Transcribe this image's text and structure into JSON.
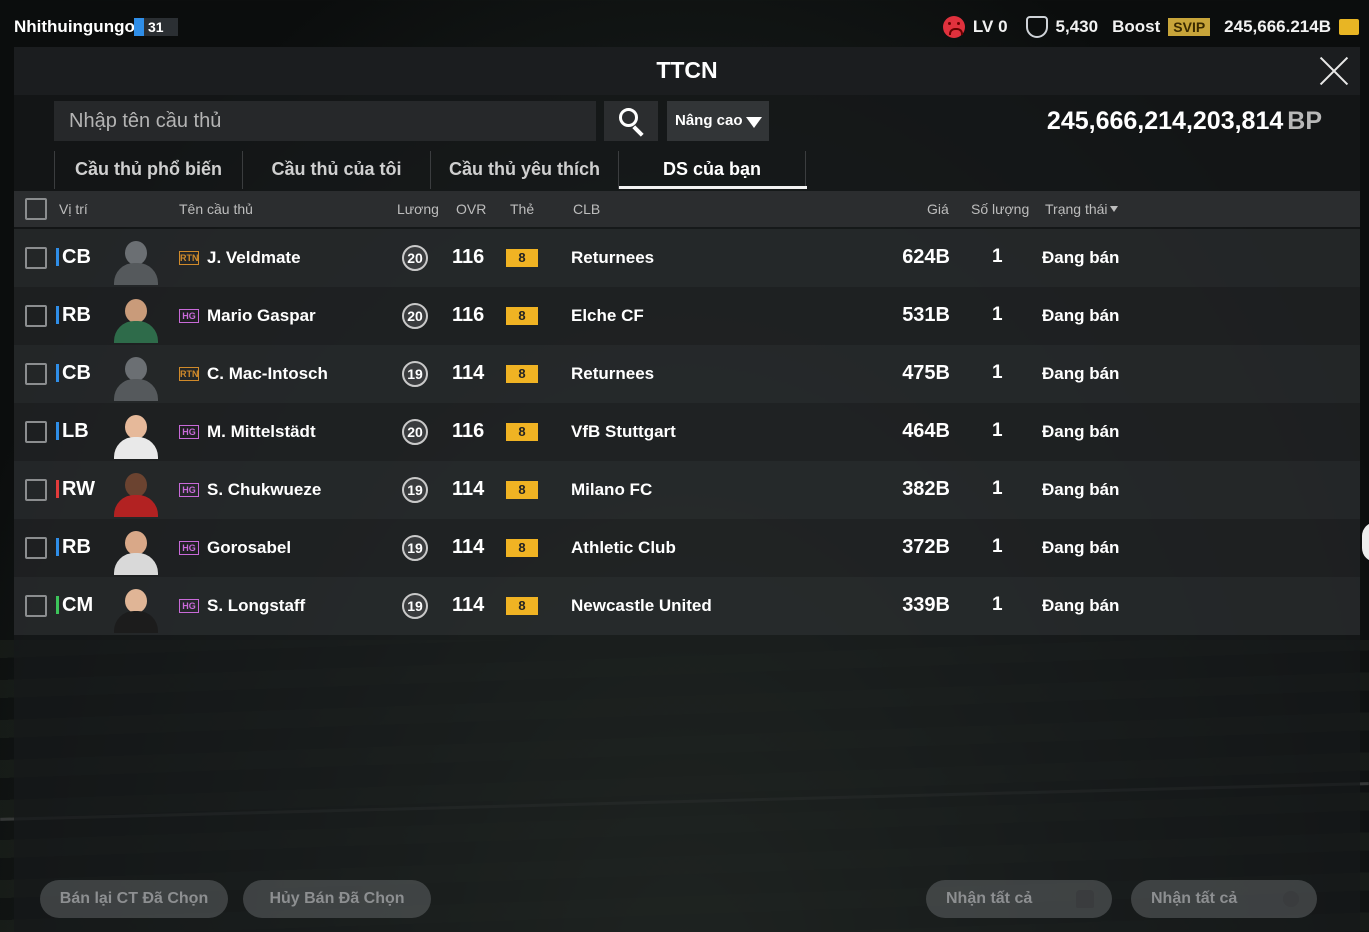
{
  "topbar": {
    "username": "Nhithuingungok",
    "level": "31",
    "lv_label": "LV 0",
    "trophy_value": "5,430",
    "boost_label": "Boost",
    "svip_label": "SVIP",
    "coins": "245,666.214B"
  },
  "panel": {
    "title": "TTCN",
    "search_placeholder": "Nhập tên cầu thủ",
    "advanced_label": "Nâng cao",
    "balance_value": "245,666,214,203,814",
    "balance_unit": "BP"
  },
  "tabs": [
    {
      "label": "Cầu thủ phổ biến",
      "active": false
    },
    {
      "label": "Cầu thủ của tôi",
      "active": false
    },
    {
      "label": "Cầu thủ yêu thích",
      "active": false
    },
    {
      "label": "DS của bạn",
      "active": true
    }
  ],
  "table": {
    "headers": {
      "position": "Vị trí",
      "name": "Tên cầu thủ",
      "wage": "Lương",
      "ovr": "OVR",
      "card": "Thẻ",
      "club": "CLB",
      "price": "Giá",
      "quantity": "Số lượng",
      "status": "Trạng thái"
    },
    "rows": [
      {
        "position": "CB",
        "pos_color": "#2f8ee8",
        "season": "RTN",
        "name": "J. Veldmate",
        "wage": "20",
        "ovr": "116",
        "grade": "8",
        "club": "Returnees",
        "price": "624B",
        "qty": "1",
        "status": "Đang bán"
      },
      {
        "position": "RB",
        "pos_color": "#2f8ee8",
        "season": "HG",
        "name": "Mario Gaspar",
        "wage": "20",
        "ovr": "116",
        "grade": "8",
        "club": "Elche CF",
        "price": "531B",
        "qty": "1",
        "status": "Đang bán"
      },
      {
        "position": "CB",
        "pos_color": "#2f8ee8",
        "season": "RTN",
        "name": "C. Mac-Intosch",
        "wage": "19",
        "ovr": "114",
        "grade": "8",
        "club": "Returnees",
        "price": "475B",
        "qty": "1",
        "status": "Đang bán"
      },
      {
        "position": "LB",
        "pos_color": "#2f8ee8",
        "season": "HG",
        "name": "M. Mittelstädt",
        "wage": "20",
        "ovr": "116",
        "grade": "8",
        "club": "VfB Stuttgart",
        "price": "464B",
        "qty": "1",
        "status": "Đang bán"
      },
      {
        "position": "RW",
        "pos_color": "#e23b3b",
        "season": "HG",
        "name": "S. Chukwueze",
        "wage": "19",
        "ovr": "114",
        "grade": "8",
        "club": "Milano FC",
        "price": "382B",
        "qty": "1",
        "status": "Đang bán"
      },
      {
        "position": "RB",
        "pos_color": "#2f8ee8",
        "season": "HG",
        "name": "Gorosabel",
        "wage": "19",
        "ovr": "114",
        "grade": "8",
        "club": "Athletic Club",
        "price": "372B",
        "qty": "1",
        "status": "Đang bán"
      },
      {
        "position": "CM",
        "pos_color": "#3cc45a",
        "season": "HG",
        "name": "S. Longstaff",
        "wage": "19",
        "ovr": "114",
        "grade": "8",
        "club": "Newcastle United",
        "price": "339B",
        "qty": "1",
        "status": "Đang bán"
      }
    ]
  },
  "footer": {
    "resell_selected": "Bán lại CT Đã Chọn",
    "cancel_selected": "Hủy Bán Đã Chọn",
    "claim_all_players": "Nhận tất cả",
    "claim_all_bp": "Nhận tất cả"
  },
  "colors": {
    "grade_gold": "#f0b323",
    "defender_blue": "#2f8ee8",
    "forward_red": "#e23b3b",
    "midfield_green": "#3cc45a",
    "rtn_season": "#d08a2a",
    "hg_season": "#c86ad8"
  }
}
